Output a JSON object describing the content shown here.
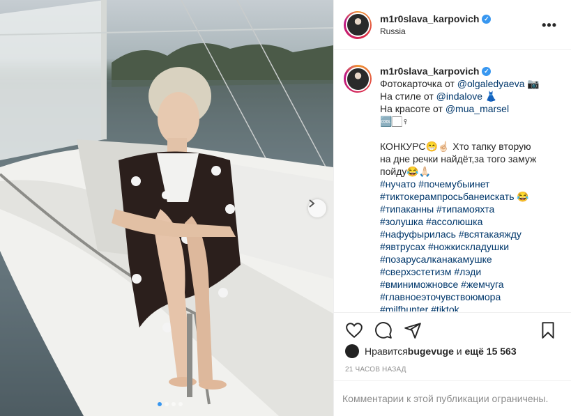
{
  "post": {
    "username": "m1r0slava_karpovich",
    "verified_mark": "✓",
    "location": "Russia",
    "more_icon": "•••"
  },
  "caption": {
    "username": "m1r0slava_karpovich",
    "line1_prefix": "Фотокарточка от ",
    "line1_mention": "@olgaledyaeva",
    "line1_emoji": " 📷",
    "line2_prefix": "На стиле от ",
    "line2_mention": "@indalove",
    "line2_emoji": " 👗",
    "line3_prefix": "На красоте от ",
    "line3_mention": "@mua_marsel",
    "line4": "🆒🏻♀",
    "contest_line1": "КОНКУРС😁☝🏻 Хто тапку вторую",
    "contest_line2": "на дне речки найдёт,за того замуж",
    "contest_line3": "пойду😂🙏🏻",
    "hashtags": [
      "#нучато #почемубыинет",
      "#тиктокерампросьбанеискать 😂",
      "#типаканны #типамояхта",
      "#золушка #ассолюшка",
      "#нафуфырилась #всятакаяжду",
      "#явтрусах #ножкискладушки",
      "#позарусалканакамушке",
      "#сверхэстетизм #лэди",
      "#вминиможновсе #жемчуга",
      "#главноеэточувствоюмора",
      "#milfhunter #tiktok"
    ]
  },
  "actions": {
    "like_icon": "heart-icon",
    "comment_icon": "comment-icon",
    "share_icon": "share-icon",
    "save_icon": "bookmark-icon"
  },
  "likes": {
    "prefix": "Нравится ",
    "user": "bugevuge",
    "middle": " и ",
    "rest": "ещё 15 563"
  },
  "timestamp": "21 ЧАСОВ НАЗАД",
  "comments_disabled": "Комментарии к этой публикации ограничены.",
  "carousel": {
    "total": 4,
    "current": 1,
    "next_icon": "chevron-right-icon"
  },
  "colors": {
    "link": "#00376b",
    "verified": "#3897f0",
    "border": "#efefef",
    "muted": "#8e8e8e"
  }
}
